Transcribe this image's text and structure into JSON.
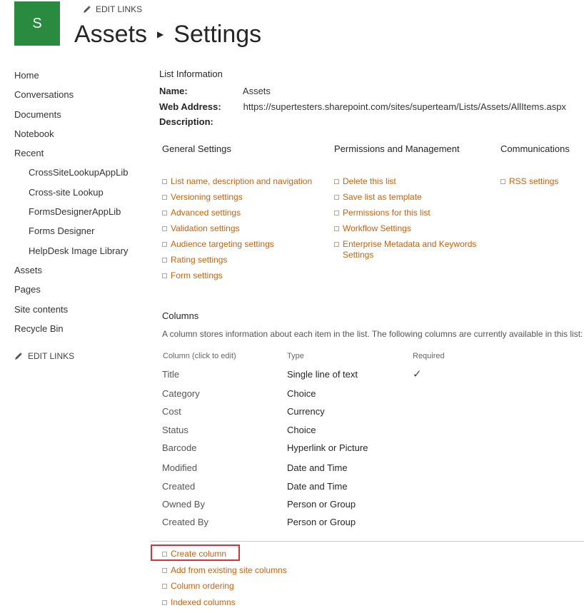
{
  "header": {
    "logo_letter": "S",
    "edit_links": "EDIT LINKS",
    "title_part1": "Assets",
    "title_part2": "Settings"
  },
  "quick_launch": {
    "items": [
      {
        "label": "Home"
      },
      {
        "label": "Conversations"
      },
      {
        "label": "Documents"
      },
      {
        "label": "Notebook"
      },
      {
        "label": "Recent"
      },
      {
        "label": "CrossSiteLookupAppLib"
      },
      {
        "label": "Cross-site Lookup"
      },
      {
        "label": "FormsDesignerAppLib"
      },
      {
        "label": "Forms Designer"
      },
      {
        "label": "HelpDesk Image Library"
      },
      {
        "label": "Assets"
      },
      {
        "label": "Pages"
      },
      {
        "label": "Site contents"
      },
      {
        "label": "Recycle Bin"
      }
    ],
    "edit_links": "EDIT LINKS"
  },
  "list_info": {
    "title": "List Information",
    "name_label": "Name:",
    "name_value": "Assets",
    "web_label": "Web Address:",
    "web_value": "https://supertesters.sharepoint.com/sites/superteam/Lists/Assets/AllItems.aspx",
    "desc_label": "Description:"
  },
  "general": {
    "title": "General Settings",
    "links": [
      "List name, description and navigation",
      "Versioning settings",
      "Advanced settings",
      "Validation settings",
      "Audience targeting settings",
      "Rating settings",
      "Form settings"
    ]
  },
  "permissions": {
    "title": "Permissions and Management",
    "links": [
      "Delete this list",
      "Save list as template",
      "Permissions for this list",
      "Workflow Settings",
      "Enterprise Metadata and Keywords Settings"
    ]
  },
  "communications": {
    "title": "Communications",
    "links": [
      "RSS settings"
    ]
  },
  "columns": {
    "title": "Columns",
    "description": "A column stores information about each item in the list. The following columns are currently available in this list:",
    "header_name": "Column (click to edit)",
    "header_type": "Type",
    "header_required": "Required",
    "rows": [
      {
        "name": "Title",
        "type": "Single line of text",
        "required": "✓"
      },
      {
        "name": "Category",
        "type": "Choice",
        "required": ""
      },
      {
        "name": "Cost",
        "type": "Currency",
        "required": ""
      },
      {
        "name": "Status",
        "type": "Choice",
        "required": ""
      },
      {
        "name": "Barcode",
        "type": "Hyperlink or Picture",
        "required": ""
      },
      {
        "name": "Modified",
        "type": "Date and Time",
        "required": ""
      },
      {
        "name": "Created",
        "type": "Date and Time",
        "required": ""
      },
      {
        "name": "Owned By",
        "type": "Person or Group",
        "required": ""
      },
      {
        "name": "Created By",
        "type": "Person or Group",
        "required": ""
      }
    ],
    "actions": [
      "Create column",
      "Add from existing site columns",
      "Column ordering",
      "Indexed columns"
    ]
  },
  "colors": {
    "link": "#c0640f",
    "logo": "#2a8a3f",
    "highlight": "#d9323f"
  }
}
